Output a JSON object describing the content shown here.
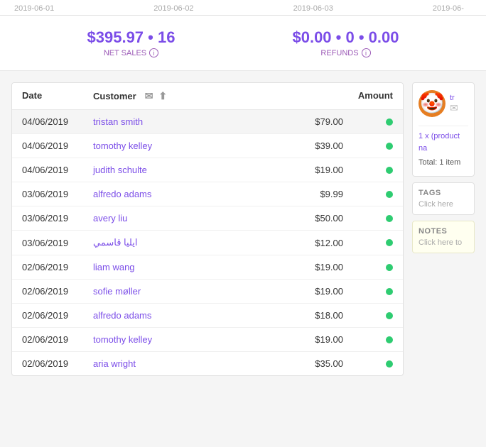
{
  "chart": {
    "dates": [
      "2019-06-01",
      "2019-06-02",
      "2019-06-03",
      "2019-06-"
    ]
  },
  "summary": {
    "net_sales_value": "$395.97 • 16",
    "net_sales_label": "NET SALES",
    "refunds_value": "$0.00 • 0 • 0.00",
    "refunds_label": "REFUNDS",
    "info_icon_label": "i"
  },
  "table": {
    "headers": {
      "date": "Date",
      "customer": "Customer",
      "amount": "Amount"
    },
    "rows": [
      {
        "date": "04/06/2019",
        "customer": "tristan smith",
        "amount": "$79.00",
        "selected": true
      },
      {
        "date": "04/06/2019",
        "customer": "tomothy kelley",
        "amount": "$39.00",
        "selected": false
      },
      {
        "date": "04/06/2019",
        "customer": "judith schulte",
        "amount": "$19.00",
        "selected": false
      },
      {
        "date": "03/06/2019",
        "customer": "alfredo adams",
        "amount": "$9.99",
        "selected": false
      },
      {
        "date": "03/06/2019",
        "customer": "avery liu",
        "amount": "$50.00",
        "selected": false
      },
      {
        "date": "03/06/2019",
        "customer": "ايليا قاسمي",
        "amount": "$12.00",
        "selected": false
      },
      {
        "date": "02/06/2019",
        "customer": "liam wang",
        "amount": "$19.00",
        "selected": false
      },
      {
        "date": "02/06/2019",
        "customer": "sofie møller",
        "amount": "$19.00",
        "selected": false
      },
      {
        "date": "02/06/2019",
        "customer": "alfredo adams",
        "amount": "$18.00",
        "selected": false
      },
      {
        "date": "02/06/2019",
        "customer": "tomothy kelley",
        "amount": "$19.00",
        "selected": false
      },
      {
        "date": "02/06/2019",
        "customer": "aria wright",
        "amount": "$35.00",
        "selected": false
      }
    ]
  },
  "side_panel": {
    "customer_name": "tr",
    "avatar_emoji": "🤡",
    "email_icon": "✉",
    "product_line": "1 x (product na",
    "total_line": "Total: 1 item",
    "tags_title": "TAGS",
    "tags_click": "Click here",
    "notes_title": "NOTES",
    "notes_click": "Click here to"
  }
}
